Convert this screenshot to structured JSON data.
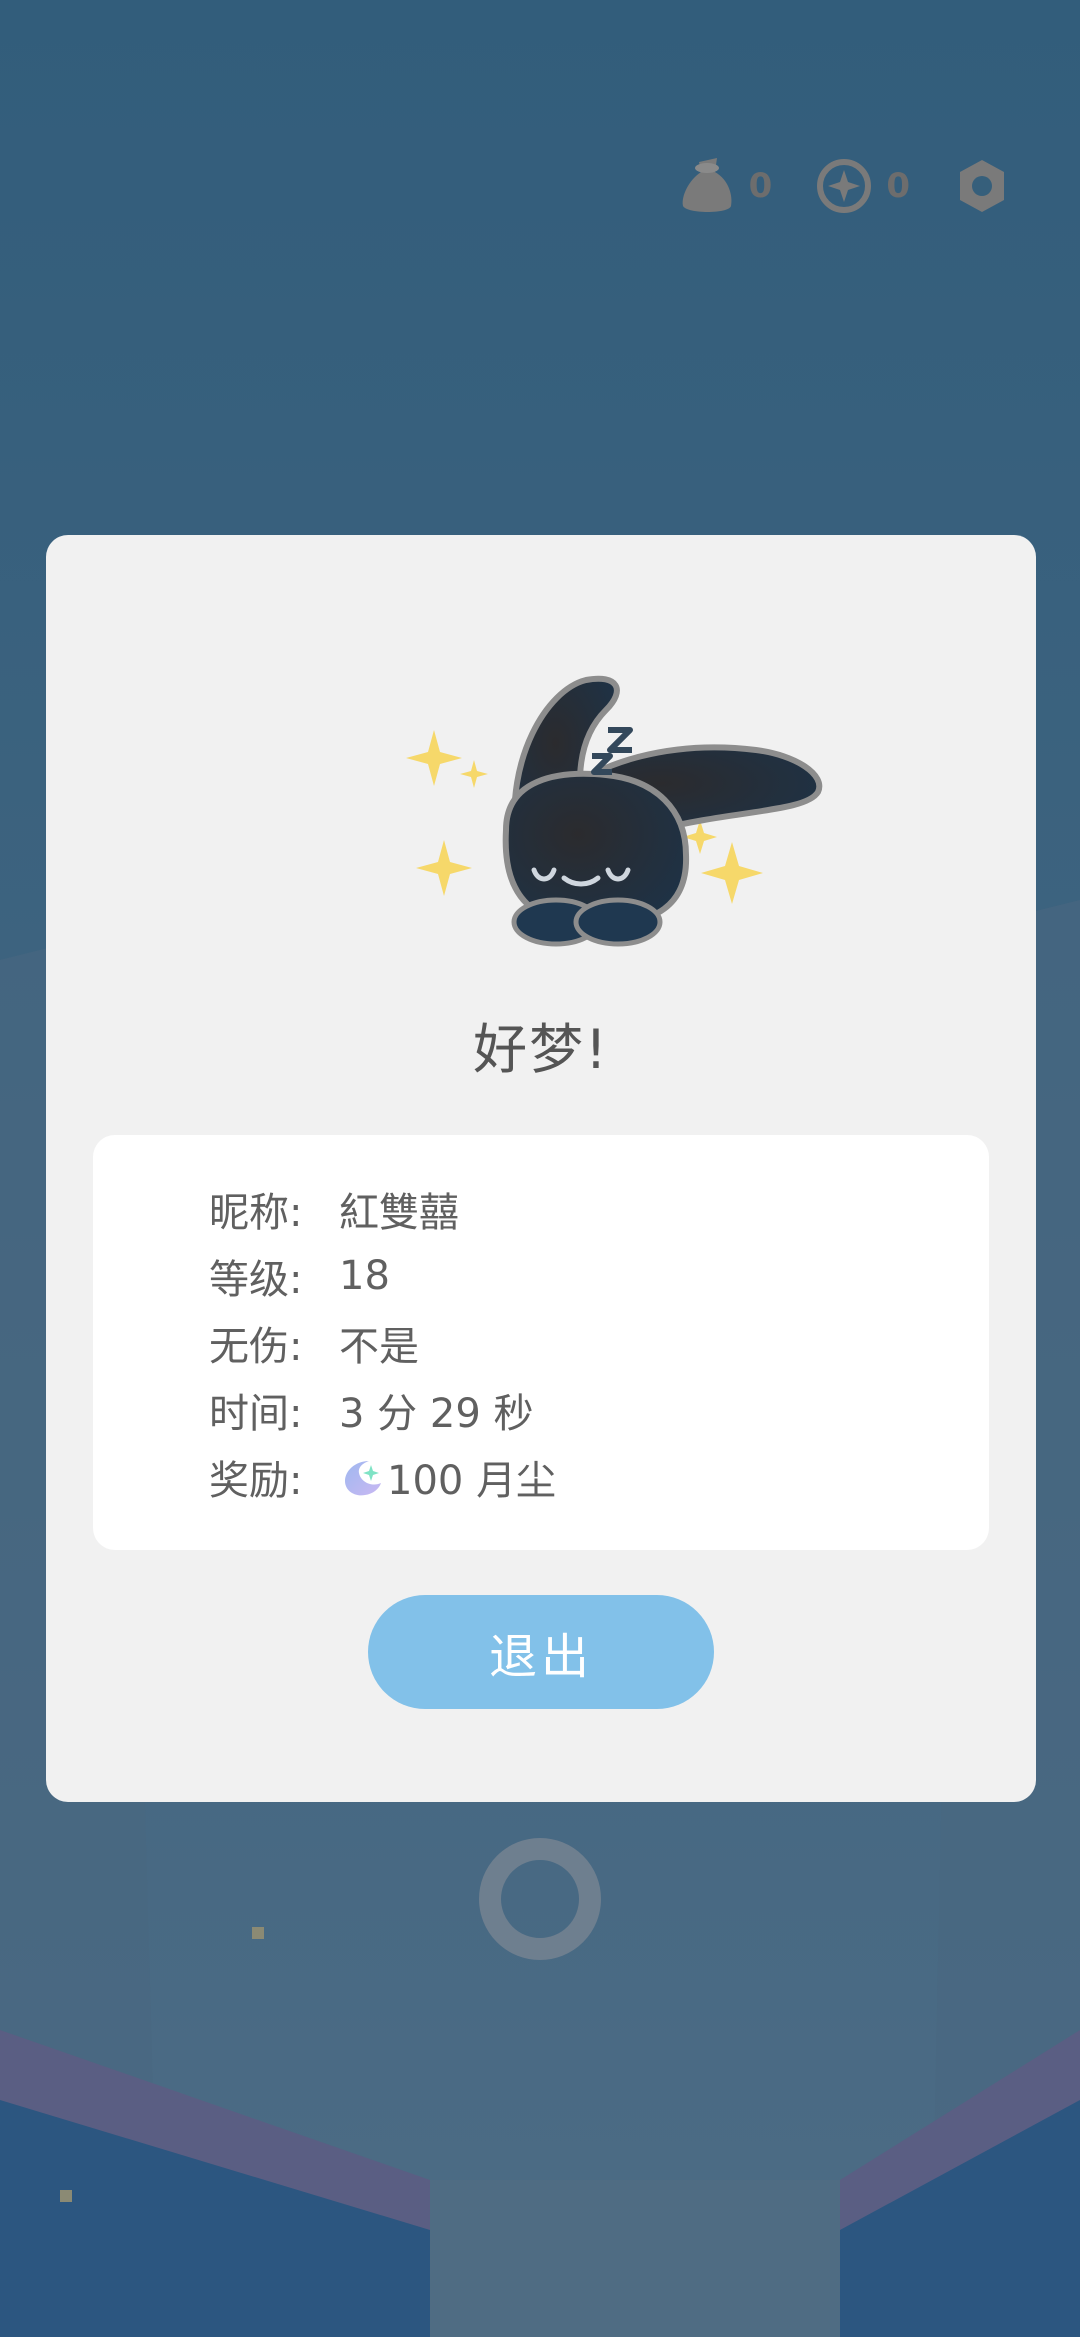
{
  "hud": {
    "bag_count": "0",
    "coin_count": "0",
    "icons": [
      "bag-icon",
      "coin-icon",
      "settings-icon"
    ]
  },
  "dialog": {
    "title": "好梦!",
    "info": {
      "nickname_label": "昵称:",
      "nickname_value": "紅雙囍",
      "level_label": "等级:",
      "level_value": "18",
      "no_damage_label": "无伤:",
      "no_damage_value": "不是",
      "time_label": "时间:",
      "time_value": "3 分 29 秒",
      "reward_label": "奖励:",
      "reward_value": "100 月尘"
    },
    "exit_label": "退出"
  },
  "colors": {
    "background": "#355f7c",
    "dialog": "#f1f1f1",
    "card": "#ffffff",
    "button": "#82c1e9",
    "text": "#606060"
  }
}
